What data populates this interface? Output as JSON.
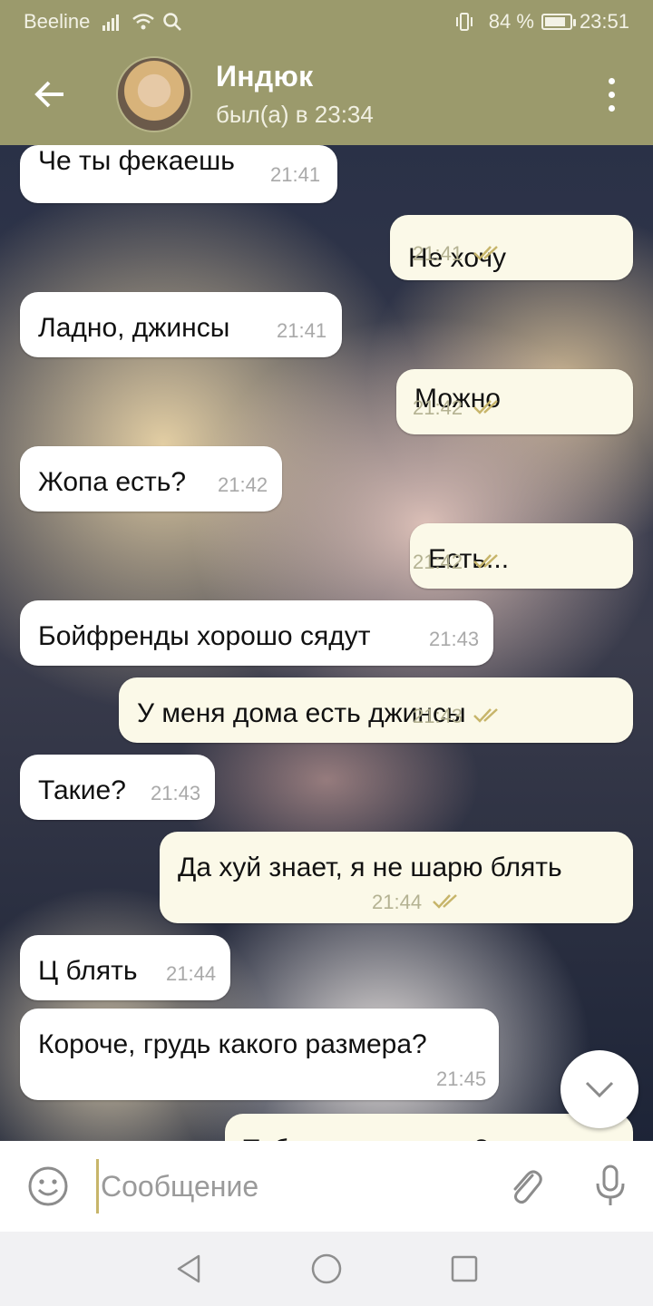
{
  "status_bar": {
    "carrier": "Beeline",
    "battery_percent": "84 %",
    "battery_level": 0.84,
    "time": "23:51"
  },
  "header": {
    "name": "Индюк",
    "status": "был(а) в 23:34"
  },
  "messages": [
    {
      "dir": "in",
      "text": "Че ты фекаешь",
      "time": "21:41"
    },
    {
      "dir": "out",
      "text": "Не хочу",
      "time": "21:41",
      "read": true
    },
    {
      "dir": "in",
      "text": "Ладно, джинсы",
      "time": "21:41"
    },
    {
      "dir": "out",
      "text": "Можно",
      "time": "21:42",
      "read": true
    },
    {
      "dir": "in",
      "text": "Жопа есть?",
      "time": "21:42"
    },
    {
      "dir": "out",
      "text": "Есть...",
      "time": "21:42",
      "read": true
    },
    {
      "dir": "in",
      "text": "Бойфренды хорошо сядут",
      "time": "21:43"
    },
    {
      "dir": "out",
      "text": "У меня дома есть джинсы",
      "time": "21:43",
      "read": true
    },
    {
      "dir": "in",
      "text": "Такие?",
      "time": "21:43"
    },
    {
      "dir": "out",
      "text": "Да хуй знает, я не шарю блять",
      "time": "21:44",
      "read": true
    },
    {
      "dir": "in",
      "text": "Ц блять",
      "time": "21:44"
    },
    {
      "dir": "in",
      "text": "Короче, грудь какого размера?",
      "time": "21:45"
    },
    {
      "dir": "out",
      "text": "Тебе то оно зачем?",
      "time": "",
      "read": false
    }
  ],
  "input": {
    "placeholder": "Сообщение"
  },
  "icons": {
    "back": "arrow-left-icon",
    "menu": "more-vert-icon",
    "emoji": "smiley-icon",
    "attach": "paperclip-icon",
    "mic": "microphone-icon",
    "scroll_down": "chevron-down-icon",
    "read_receipt": "double-check-icon"
  },
  "colors": {
    "header": "#9b9a6c",
    "incoming_bubble": "#ffffff",
    "outgoing_bubble": "#fbf9e8",
    "read_check": "#c7b56a"
  }
}
